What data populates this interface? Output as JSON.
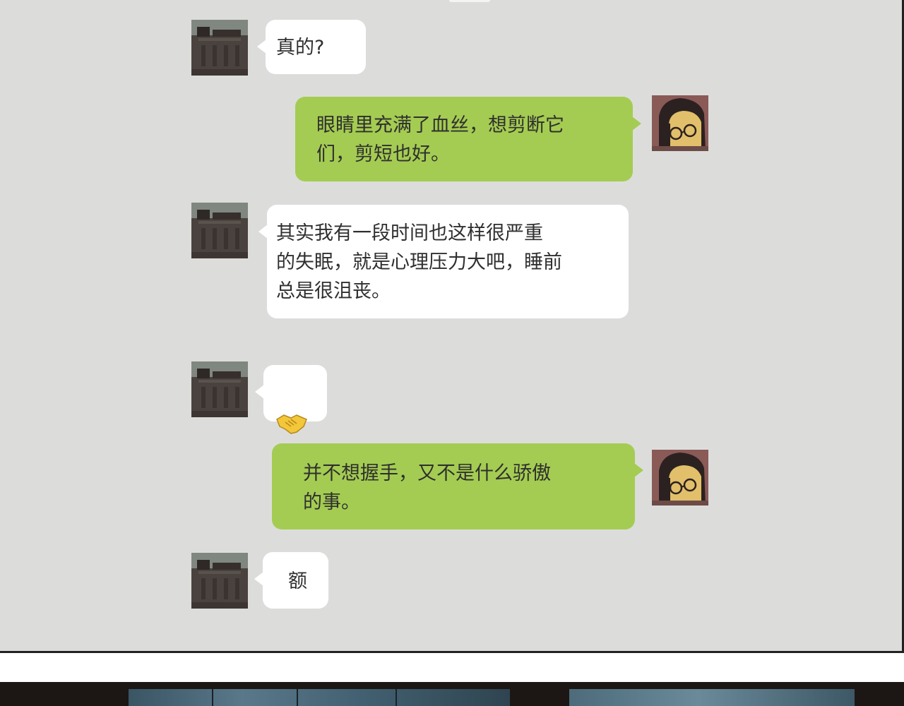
{
  "messages": [
    {
      "sender": "friend",
      "text": "真的?"
    },
    {
      "sender": "me",
      "text": "眼睛里充满了血丝，想剪断它\n们，剪短也好。"
    },
    {
      "sender": "friend",
      "text": "其实我有一段时间也这样很严重\n的失眠，就是心理压力大吧，睡前\n总是很沮丧。"
    },
    {
      "sender": "friend",
      "text": "🤝"
    },
    {
      "sender": "me",
      "text": "并不想握手，又不是什么骄傲\n的事。"
    },
    {
      "sender": "friend",
      "text": "额"
    }
  ],
  "colors": {
    "panel_bg": "#dcdddb",
    "my_bubble": "#a4cc52",
    "friend_bubble": "#ffffff",
    "text": "#2f2f2f"
  },
  "icons": {
    "friend_avatar": "dark-building-avatar",
    "my_avatar": "glasses-girl-avatar",
    "handshake": "handshake-emoji"
  }
}
